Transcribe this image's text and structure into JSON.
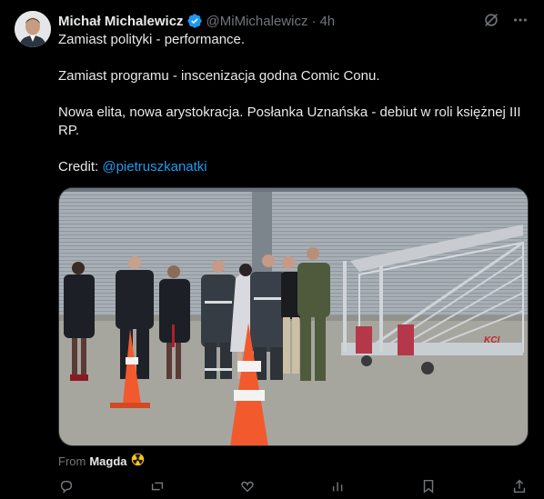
{
  "author": {
    "name": "Michał Michalewicz",
    "handle": "@MiMichalewicz",
    "separator": "·",
    "time": "4h"
  },
  "tweet": {
    "line1": "Zamiast polityki - performance.",
    "line2": "Zamiast programu - inscenizacja godna Comic Conu.",
    "line3": "Nowa elita, nowa arystokracja. Posłanka Uznańska - debiut w roli księżnej III RP.",
    "credit_label": "Credit: ",
    "credit_mention": "@pietruszkanatki"
  },
  "media": {
    "stairs_logo": "KCI"
  },
  "from": {
    "label": "From",
    "name": "Magda"
  },
  "colors": {
    "background": "#000000",
    "text": "#e7e9ea",
    "muted": "#71767b",
    "accent": "#1d9bf0"
  },
  "icons": [
    "verified-badge-icon",
    "grok-icon",
    "more-icon",
    "radiation-icon"
  ]
}
